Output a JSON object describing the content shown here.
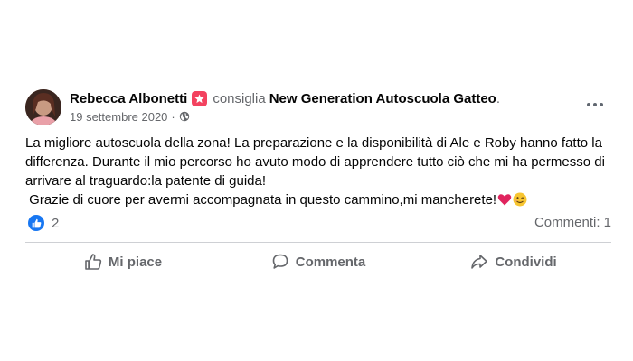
{
  "post": {
    "author": "Rebecca Albonetti",
    "verb": "consiglia",
    "page": "New Generation Autoscuola Gatteo",
    "page_suffix": ".",
    "date": "19 settembre 2020",
    "date_sep": "·",
    "text_lines": [
      "La migliore autoscuola della zona! La preparazione e la disponibilità di Ale e Roby hanno fatto la",
      "differenza. Durante il mio percorso ho avuto modo di apprendere tutto ciò che mi ha permesso di",
      "arrivare al traguardo:la patente di guida!",
      " Grazie di cuore per avermi accompagnata in questo cammino,mi mancherete!"
    ]
  },
  "reactions": {
    "count": "2"
  },
  "comments": {
    "label": "Commenti: 1"
  },
  "actions": {
    "like": "Mi piace",
    "comment": "Commenta",
    "share": "Condividi"
  },
  "icons": {
    "recommend_badge": "star-badge-icon",
    "privacy": "globe-icon",
    "more": "more-options-icon",
    "like": "thumbs-up-icon",
    "comment": "comment-bubble-icon",
    "share": "share-arrow-icon",
    "emoji1": "red-heart-emoji",
    "emoji2": "winking-face-emoji"
  },
  "colors": {
    "like_blue": "#1877f2",
    "badge_red": "#f3425f",
    "secondary_text": "#65676b"
  }
}
